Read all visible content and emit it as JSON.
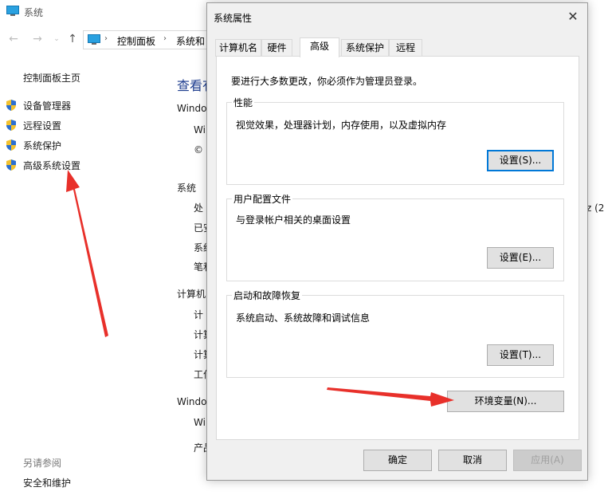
{
  "background_window": {
    "title": "系统",
    "breadcrumb": [
      "控制面板",
      "系统和"
    ],
    "sidebar": {
      "home": "控制面板主页",
      "items": [
        "设备管理器",
        "远程设置",
        "系统保护",
        "高级系统设置"
      ],
      "see_also": "另请参阅",
      "security": "安全和维护"
    },
    "main": {
      "heading": "查看有",
      "sections": [
        "Windo",
        "系统",
        "计算机",
        "Windo"
      ],
      "rows_win": [
        "Wi",
        "©"
      ],
      "rows_sys": [
        "处",
        "已安",
        "系统",
        "笔和"
      ],
      "rows_comp": [
        "计",
        "计算",
        "计算",
        "工作"
      ],
      "rows_win2": [
        "Wi",
        "产品"
      ],
      "right_fragment": "z (2"
    }
  },
  "dialog": {
    "title": "系统属性",
    "tabs": [
      "计算机名",
      "硬件",
      "高级",
      "系统保护",
      "远程"
    ],
    "active_tab": "高级",
    "admin_note": "要进行大多数更改，你必须作为管理员登录。",
    "groups": {
      "performance": {
        "label": "性能",
        "description": "视觉效果，处理器计划，内存使用，以及虚拟内存",
        "button": "设置(S)..."
      },
      "user_profiles": {
        "label": "用户配置文件",
        "description": "与登录帐户相关的桌面设置",
        "button": "设置(E)..."
      },
      "startup": {
        "label": "启动和故障恢复",
        "description": "系统启动、系统故障和调试信息",
        "button": "设置(T)..."
      }
    },
    "env_button": "环境变量(N)...",
    "footer": {
      "ok": "确定",
      "cancel": "取消",
      "apply": "应用(A)"
    }
  },
  "colors": {
    "annotation_arrow": "#e8302a",
    "focus_border": "#0078d7",
    "heading_blue": "#1e3d8f"
  }
}
